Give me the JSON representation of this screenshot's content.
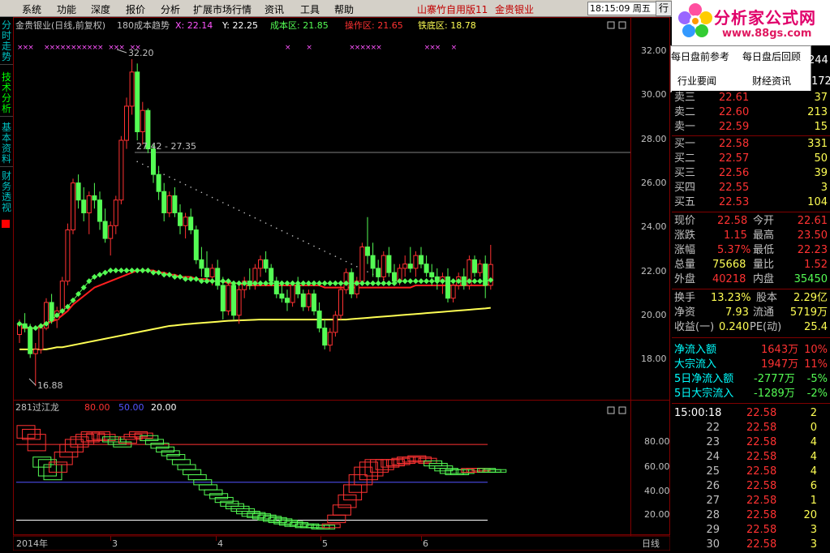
{
  "menu": {
    "items": [
      "系统",
      "功能",
      "深度",
      "报价",
      "分析",
      "扩展市场行情",
      "资讯",
      "工具",
      "帮助"
    ],
    "app_title": "山寨竹自用版11",
    "stock_name": "金贵银业",
    "clock": "18:15:09 周五",
    "right_button": "行"
  },
  "logo": {
    "brand": "分析家公式网",
    "url": "www.88gs.com"
  },
  "popup": {
    "items": [
      "每日盘前参考",
      "每日盘后回顾",
      "行业要闻",
      "财经资讯"
    ]
  },
  "side_tabs": [
    "分时走势",
    "技术分析",
    "基本资料",
    "财务透视"
  ],
  "main_header": {
    "title": "金贵银业(日线,前复权)",
    "indicator": "180成本趋势",
    "x_label": "X: 22.14",
    "y_label": "Y: 22.25",
    "cost_label": "成本区: 21.85",
    "op_label": "操作区: 21.65",
    "bottom_label": "铁底区: 18.78",
    "price_ticks": [
      "32.00",
      "30.00",
      "28.00",
      "26.00",
      "24.00",
      "22.00",
      "20.00",
      "18.00"
    ],
    "high_mark": "32.20",
    "low_mark": "16.88",
    "range_mark": "27.42 - 27.35"
  },
  "sub_header": {
    "title": "281过江龙",
    "v1": "80.00",
    "v2": "50.00",
    "v3": "20.00",
    "ticks": [
      "80.00",
      "60.00",
      "40.00",
      "20.00"
    ]
  },
  "time_axis": {
    "labels": [
      "2014年",
      "3",
      "4",
      "5",
      "6"
    ],
    "period": "日线"
  },
  "quote": {
    "top_rows": [
      {
        "label": "卖三",
        "price": "22.61",
        "vol": "37"
      },
      {
        "label": "卖二",
        "price": "22.60",
        "vol": "213"
      },
      {
        "label": "卖一",
        "price": "22.59",
        "vol": "15"
      }
    ],
    "partial_vols": [
      "244",
      "172"
    ],
    "bids": [
      {
        "label": "买一",
        "price": "22.58",
        "vol": "331"
      },
      {
        "label": "买二",
        "price": "22.57",
        "vol": "50"
      },
      {
        "label": "买三",
        "price": "22.56",
        "vol": "39"
      },
      {
        "label": "买四",
        "price": "22.55",
        "vol": "3"
      },
      {
        "label": "买五",
        "price": "22.53",
        "vol": "104"
      }
    ],
    "stats": [
      {
        "l1": "现价",
        "v1": "22.58",
        "l2": "今开",
        "v2": "22.61"
      },
      {
        "l1": "涨跌",
        "v1": "1.15",
        "l2": "最高",
        "v2": "23.50"
      },
      {
        "l1": "涨幅",
        "v1": "5.37%",
        "l2": "最低",
        "v2": "22.23"
      },
      {
        "l1": "总量",
        "v1": "75668",
        "l2": "量比",
        "v2": "1.52"
      },
      {
        "l1": "外盘",
        "v1": "40218",
        "l2": "内盘",
        "v2": "35450"
      }
    ],
    "fund": [
      {
        "l1": "换手",
        "v1": "13.23%",
        "l2": "股本",
        "v2": "2.29亿"
      },
      {
        "l1": "净资",
        "v1": "7.93",
        "l2": "流通",
        "v2": "5719万"
      },
      {
        "l1": "收益(一)",
        "v1": "0.240",
        "l2": "PE(动)",
        "v2": "25.4"
      }
    ],
    "flows": [
      {
        "label": "净流入额",
        "value": "1643万",
        "pct": "10%"
      },
      {
        "label": "大宗流入",
        "value": "1947万",
        "pct": "11%"
      },
      {
        "label": "5日净流入额",
        "value": "-2777万",
        "pct": "-5%"
      },
      {
        "label": "5日大宗流入",
        "value": "-1289万",
        "pct": "-2%"
      }
    ],
    "ticks": [
      {
        "time": "15:00:18",
        "price": "22.58",
        "vol": "2"
      },
      {
        "time": "22",
        "price": "22.58",
        "vol": "0"
      },
      {
        "time": "23",
        "price": "22.58",
        "vol": "4"
      },
      {
        "time": "24",
        "price": "22.58",
        "vol": "4"
      },
      {
        "time": "25",
        "price": "22.58",
        "vol": "4"
      },
      {
        "time": "26",
        "price": "22.58",
        "vol": "6"
      },
      {
        "time": "27",
        "price": "22.58",
        "vol": "1"
      },
      {
        "time": "28",
        "price": "22.58",
        "vol": "20"
      },
      {
        "time": "29",
        "price": "22.58",
        "vol": "3"
      },
      {
        "time": "30",
        "price": "22.58",
        "vol": "3"
      }
    ]
  },
  "colors": {
    "up": "#ff3232",
    "down": "#54fc54",
    "yellow": "#ffff54",
    "pink": "#ff54ff",
    "blue": "#5454ff",
    "cyan": "#00ffff"
  },
  "chart_data": {
    "type": "candlestick",
    "price_range": [
      17.0,
      33.0
    ],
    "candles": [
      [
        19.3,
        20.0,
        18.9,
        19.8
      ],
      [
        19.8,
        20.3,
        19.4,
        19.6
      ],
      [
        19.6,
        19.8,
        18.2,
        18.4
      ],
      [
        18.4,
        18.9,
        16.88,
        18.6
      ],
      [
        18.6,
        19.8,
        18.4,
        19.6
      ],
      [
        19.6,
        21.0,
        19.5,
        20.8
      ],
      [
        20.8,
        21.2,
        19.8,
        20.0
      ],
      [
        20.0,
        20.6,
        19.6,
        20.4
      ],
      [
        20.4,
        22.0,
        20.2,
        21.8
      ],
      [
        21.8,
        24.5,
        21.6,
        24.2
      ],
      [
        24.2,
        26.6,
        24.0,
        26.4
      ],
      [
        26.4,
        26.8,
        25.2,
        25.6
      ],
      [
        25.6,
        26.2,
        24.6,
        25.0
      ],
      [
        25.0,
        26.0,
        24.0,
        25.8
      ],
      [
        25.8,
        26.4,
        25.2,
        25.6
      ],
      [
        25.6,
        26.0,
        24.2,
        24.6
      ],
      [
        24.6,
        25.2,
        23.6,
        23.8
      ],
      [
        23.8,
        24.6,
        23.0,
        24.4
      ],
      [
        24.4,
        25.8,
        24.0,
        25.6
      ],
      [
        25.6,
        28.6,
        25.4,
        28.4
      ],
      [
        28.4,
        30.4,
        28.0,
        30.0
      ],
      [
        30.0,
        32.2,
        29.6,
        31.6
      ],
      [
        31.6,
        32.0,
        28.4,
        28.8
      ],
      [
        28.8,
        30.2,
        28.2,
        29.8
      ],
      [
        29.8,
        29.9,
        27.8,
        28.0
      ],
      [
        28.0,
        28.2,
        26.4,
        26.8
      ],
      [
        26.8,
        27.2,
        25.6,
        26.0
      ],
      [
        26.0,
        26.4,
        24.6,
        25.0
      ],
      [
        25.0,
        26.0,
        24.8,
        25.8
      ],
      [
        25.8,
        26.2,
        24.8,
        25.0
      ],
      [
        25.0,
        25.4,
        24.0,
        24.4
      ],
      [
        24.4,
        25.0,
        23.8,
        24.8
      ],
      [
        24.8,
        25.2,
        24.0,
        24.2
      ],
      [
        24.2,
        24.4,
        22.6,
        22.8
      ],
      [
        22.8,
        23.4,
        22.0,
        22.4
      ],
      [
        22.4,
        23.2,
        21.8,
        22.0
      ],
      [
        22.0,
        22.6,
        21.6,
        22.4
      ],
      [
        22.4,
        22.8,
        21.4,
        21.6
      ],
      [
        21.6,
        22.0,
        20.0,
        20.4
      ],
      [
        20.4,
        21.8,
        20.2,
        21.6
      ],
      [
        21.6,
        21.8,
        20.0,
        20.2
      ],
      [
        20.2,
        21.6,
        19.8,
        21.4
      ],
      [
        21.4,
        22.0,
        21.0,
        21.8
      ],
      [
        21.8,
        22.4,
        21.4,
        21.6
      ],
      [
        21.6,
        22.6,
        21.4,
        22.4
      ],
      [
        22.4,
        23.0,
        22.0,
        22.8
      ],
      [
        22.8,
        23.2,
        22.2,
        22.4
      ],
      [
        22.4,
        22.6,
        21.6,
        21.8
      ],
      [
        21.8,
        22.0,
        21.0,
        21.2
      ],
      [
        21.2,
        21.6,
        20.8,
        21.0
      ],
      [
        21.0,
        21.4,
        20.4,
        20.8
      ],
      [
        20.8,
        21.8,
        20.6,
        21.6
      ],
      [
        21.6,
        22.0,
        21.0,
        21.2
      ],
      [
        21.2,
        21.4,
        20.4,
        20.6
      ],
      [
        20.6,
        21.4,
        20.4,
        21.2
      ],
      [
        21.2,
        21.4,
        20.2,
        20.4
      ],
      [
        20.4,
        20.8,
        19.4,
        19.6
      ],
      [
        19.6,
        20.0,
        18.6,
        18.8
      ],
      [
        18.8,
        19.6,
        18.5,
        19.4
      ],
      [
        19.4,
        20.4,
        19.2,
        20.2
      ],
      [
        20.2,
        21.6,
        20.0,
        21.4
      ],
      [
        21.4,
        22.4,
        21.2,
        22.2
      ],
      [
        22.2,
        22.4,
        21.0,
        21.2
      ],
      [
        21.2,
        22.0,
        21.0,
        21.8
      ],
      [
        21.8,
        23.6,
        21.6,
        23.4
      ],
      [
        23.4,
        24.8,
        22.6,
        23.0
      ],
      [
        23.0,
        23.6,
        22.0,
        22.4
      ],
      [
        22.4,
        22.8,
        21.6,
        22.0
      ],
      [
        22.0,
        23.2,
        21.8,
        23.0
      ],
      [
        23.0,
        23.4,
        22.0,
        22.2
      ],
      [
        22.2,
        22.6,
        21.6,
        21.8
      ],
      [
        21.8,
        22.6,
        21.6,
        22.4
      ],
      [
        22.4,
        23.0,
        22.0,
        22.6
      ],
      [
        22.6,
        23.4,
        22.2,
        22.4
      ],
      [
        22.4,
        23.2,
        22.0,
        23.0
      ],
      [
        23.0,
        23.4,
        22.4,
        22.6
      ],
      [
        22.6,
        23.0,
        22.0,
        22.2
      ],
      [
        22.2,
        22.6,
        21.6,
        22.0
      ],
      [
        22.0,
        22.4,
        21.4,
        21.8
      ],
      [
        21.8,
        22.2,
        21.2,
        22.0
      ],
      [
        22.0,
        22.4,
        20.8,
        21.0
      ],
      [
        21.0,
        21.8,
        20.8,
        21.6
      ],
      [
        21.6,
        22.2,
        21.4,
        22.0
      ],
      [
        22.0,
        22.4,
        21.4,
        21.6
      ],
      [
        21.6,
        23.0,
        21.4,
        22.8
      ],
      [
        22.8,
        23.0,
        22.0,
        22.2
      ],
      [
        22.2,
        22.8,
        22.0,
        22.6
      ],
      [
        22.6,
        23.0,
        21.0,
        21.6
      ],
      [
        21.6,
        23.5,
        21.4,
        22.58
      ]
    ],
    "ma_red": [
      19.6,
      19.6,
      19.6,
      19.6,
      19.7,
      19.8,
      19.9,
      20.0,
      20.2,
      20.4,
      20.7,
      20.9,
      21.1,
      21.3,
      21.5,
      21.6,
      21.7,
      21.8,
      21.9,
      22.0,
      22.1,
      22.2,
      22.3,
      22.3,
      22.3,
      22.3,
      22.2,
      22.2,
      22.1,
      22.1,
      22.0,
      22.0,
      22.0,
      21.9,
      21.9,
      21.9,
      21.8,
      21.8,
      21.8,
      21.7,
      21.7,
      21.7,
      21.6,
      21.6,
      21.6,
      21.6,
      21.6,
      21.6,
      21.6,
      21.6,
      21.6,
      21.6,
      21.6,
      21.6,
      21.6,
      21.6,
      21.6,
      21.5,
      21.5,
      21.5,
      21.5,
      21.5,
      21.5,
      21.5,
      21.5,
      21.5,
      21.5,
      21.5,
      21.5,
      21.5,
      21.5,
      21.5,
      21.5,
      21.5,
      21.6,
      21.6,
      21.6,
      21.6,
      21.6,
      21.6,
      21.6,
      21.6,
      21.6,
      21.6,
      21.6,
      21.6,
      21.6,
      21.6,
      21.65
    ],
    "ma_green": [
      19.8,
      19.7,
      19.6,
      19.6,
      19.7,
      19.8,
      20.0,
      20.2,
      20.4,
      20.6,
      20.9,
      21.2,
      21.5,
      21.8,
      22.0,
      22.1,
      22.2,
      22.3,
      22.3,
      22.3,
      22.3,
      22.3,
      22.3,
      22.3,
      22.3,
      22.2,
      22.2,
      22.1,
      22.1,
      22.0,
      22.0,
      21.9,
      21.9,
      21.9,
      21.8,
      21.8,
      21.8,
      21.8,
      21.8,
      21.8,
      21.7,
      21.7,
      21.7,
      21.7,
      21.7,
      21.7,
      21.7,
      21.7,
      21.7,
      21.7,
      21.7,
      21.7,
      21.7,
      21.7,
      21.7,
      21.7,
      21.7,
      21.7,
      21.7,
      21.7,
      21.7,
      21.7,
      21.7,
      21.7,
      21.7,
      21.7,
      21.7,
      21.7,
      21.7,
      21.7,
      21.7,
      21.8,
      21.8,
      21.8,
      21.8,
      21.8,
      21.8,
      21.8,
      21.8,
      21.8,
      21.8,
      21.8,
      21.8,
      21.8,
      21.8,
      21.8,
      21.8,
      21.8,
      21.85
    ],
    "ma_yellow": [
      18.6,
      18.6,
      18.6,
      18.6,
      18.6,
      18.6,
      18.65,
      18.7,
      18.7,
      18.75,
      18.8,
      18.85,
      18.9,
      18.95,
      19.0,
      19.05,
      19.1,
      19.15,
      19.2,
      19.25,
      19.3,
      19.35,
      19.4,
      19.45,
      19.5,
      19.55,
      19.6,
      19.65,
      19.7,
      19.72,
      19.75,
      19.78,
      19.8,
      19.82,
      19.84,
      19.86,
      19.88,
      19.9,
      19.92,
      19.94,
      19.95,
      19.96,
      19.97,
      19.98,
      19.99,
      20.0,
      20.0,
      20.0,
      20.0,
      20.0,
      20.0,
      20.0,
      20.0,
      20.0,
      20.0,
      20.0,
      20.0,
      20.0,
      20.0,
      20.0,
      20.0,
      20.0,
      20.02,
      20.04,
      20.06,
      20.08,
      20.1,
      20.12,
      20.14,
      20.16,
      20.18,
      20.2,
      20.22,
      20.24,
      20.26,
      20.28,
      20.3,
      20.32,
      20.34,
      20.36,
      20.38,
      20.4,
      20.42,
      20.44,
      20.46,
      20.48,
      20.5,
      20.52,
      20.55
    ],
    "sub_range": [
      10,
      100
    ],
    "sub_boxes": [
      [
        85,
        95,
        "up"
      ],
      [
        84,
        92,
        "up"
      ],
      [
        75,
        88,
        "up"
      ],
      [
        62,
        70,
        "down"
      ],
      [
        55,
        68,
        "down"
      ],
      [
        52,
        64,
        "down"
      ],
      [
        58,
        66,
        "up"
      ],
      [
        64,
        74,
        "up"
      ],
      [
        70,
        80,
        "up"
      ],
      [
        74,
        84,
        "up"
      ],
      [
        78,
        86,
        "up"
      ],
      [
        80,
        88,
        "up"
      ],
      [
        82,
        90,
        "up"
      ],
      [
        83,
        89,
        "up"
      ],
      [
        84,
        90,
        "up"
      ],
      [
        83,
        88,
        "up"
      ],
      [
        82,
        86,
        "down"
      ],
      [
        80,
        84,
        "down"
      ],
      [
        78,
        82,
        "down"
      ],
      [
        81,
        86,
        "up"
      ],
      [
        84,
        88,
        "up"
      ],
      [
        86,
        90,
        "up"
      ],
      [
        85,
        89,
        "up"
      ],
      [
        83,
        87,
        "down"
      ],
      [
        80,
        84,
        "down"
      ],
      [
        77,
        81,
        "down"
      ],
      [
        74,
        78,
        "down"
      ],
      [
        71,
        75,
        "down"
      ],
      [
        68,
        72,
        "down"
      ],
      [
        64,
        68,
        "down"
      ],
      [
        60,
        64,
        "down"
      ],
      [
        56,
        60,
        "down"
      ],
      [
        52,
        56,
        "down"
      ],
      [
        48,
        52,
        "down"
      ],
      [
        44,
        48,
        "down"
      ],
      [
        40,
        44,
        "down"
      ],
      [
        37,
        41,
        "down"
      ],
      [
        34,
        38,
        "down"
      ],
      [
        31,
        35,
        "down"
      ],
      [
        29,
        33,
        "down"
      ],
      [
        27,
        31,
        "down"
      ],
      [
        25,
        29,
        "down"
      ],
      [
        23,
        27,
        "down"
      ],
      [
        22,
        26,
        "down"
      ],
      [
        21,
        25,
        "down"
      ],
      [
        20,
        24,
        "down"
      ],
      [
        19,
        23,
        "down"
      ],
      [
        18,
        22,
        "down"
      ],
      [
        17,
        21,
        "down"
      ],
      [
        16,
        20,
        "down"
      ],
      [
        15,
        19,
        "down"
      ],
      [
        15,
        18,
        "down"
      ],
      [
        14,
        17,
        "down"
      ],
      [
        14,
        17,
        "down"
      ],
      [
        14,
        16,
        "down"
      ],
      [
        13,
        16,
        "down"
      ],
      [
        13,
        16,
        "down"
      ],
      [
        14,
        17,
        "up"
      ],
      [
        18,
        24,
        "up"
      ],
      [
        24,
        32,
        "up"
      ],
      [
        30,
        40,
        "up"
      ],
      [
        36,
        48,
        "up"
      ],
      [
        42,
        56,
        "up"
      ],
      [
        48,
        62,
        "up"
      ],
      [
        52,
        66,
        "up"
      ],
      [
        55,
        68,
        "up"
      ],
      [
        58,
        68,
        "up"
      ],
      [
        60,
        68,
        "up"
      ],
      [
        62,
        68,
        "up"
      ],
      [
        63,
        68,
        "up"
      ],
      [
        64,
        69,
        "up"
      ],
      [
        65,
        70,
        "up"
      ],
      [
        66,
        70,
        "up"
      ],
      [
        67,
        71,
        "up"
      ],
      [
        66,
        70,
        "up"
      ],
      [
        65,
        69,
        "up"
      ],
      [
        63,
        67,
        "down"
      ],
      [
        61,
        65,
        "down"
      ],
      [
        59,
        63,
        "down"
      ],
      [
        57,
        61,
        "down"
      ],
      [
        56,
        60,
        "down"
      ],
      [
        56,
        60,
        "down"
      ],
      [
        57,
        60,
        "down"
      ],
      [
        58,
        61,
        "up"
      ],
      [
        58,
        61,
        "up"
      ],
      [
        59,
        61,
        "up"
      ],
      [
        58,
        61,
        "down"
      ],
      [
        58,
        60,
        "down"
      ],
      [
        58,
        60,
        "down"
      ]
    ],
    "sub_lines": [
      {
        "value": 80,
        "color": "#ff3232"
      },
      {
        "value": 50,
        "color": "#5454ff"
      },
      {
        "value": 20,
        "color": "#ffffff"
      }
    ]
  }
}
